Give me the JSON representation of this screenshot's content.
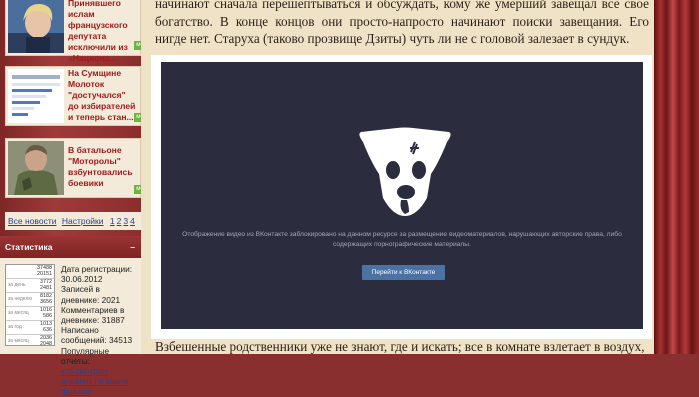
{
  "sidebar": {
    "news": [
      {
        "text": "Принявшего ислам французского депутата исключили из «Национа...",
        "more": "ме"
      },
      {
        "text": "На Сумщине Молоток \"достучался\" до избирателей и теперь стан...",
        "more": "ме"
      },
      {
        "text": "В батальоне \"Моторолы\" взбунтовались боевики",
        "more": "ме"
      }
    ],
    "news_footer": {
      "all_news": "Все новости",
      "settings": "Настройки",
      "pages": [
        "1",
        "2",
        "3",
        "4"
      ]
    },
    "stats": {
      "header": "Статистика",
      "counter_rows": [
        {
          "label": "",
          "value": "37488\n20151"
        },
        {
          "label": "за день",
          "value": "3772\n2481"
        },
        {
          "label": "за неделю",
          "value": "8182\n3656"
        },
        {
          "label": "за месяц",
          "value": "1016\n586"
        },
        {
          "label": "за год",
          "value": "1013\n636"
        },
        {
          "label": "за месяц",
          "value": "2036\n2048"
        }
      ],
      "lines": [
        "Дата регистрации: 30.06.2012",
        "Записей в дневнике: 2021",
        "Комментариев в дневнике: 31887",
        "Написано сообщений: 34513",
        "Популярные отчеты:"
      ],
      "link": "кто смотрел дневник по каким фразам"
    }
  },
  "article": {
    "paragraph_top": "начинают сначала перешептываться и обсуждать, кому же умерший завещал все свое богатство. В конце концов они просто-напросто начинают поиски завещания. Его нигде нет. Старуха (таково прозвище Дзиты) чуть ли не с головой залезает в сундук.",
    "paragraph_bottom": "Взбешенные родственники уже не знают, где и искать; все в комнате взлетает в воздух,"
  },
  "video": {
    "message": "Отображение видео из ВКонтакте заблокировано на данном ресурсе за размещение видеоматериалов, нарушающих авторские права, либо содержащих порнографические материалы.",
    "button_label": "Перейти к ВКонтакте",
    "colors": {
      "background": "#2b2d3e",
      "button": "#4b72a4",
      "text": "#a3a7b7"
    }
  }
}
